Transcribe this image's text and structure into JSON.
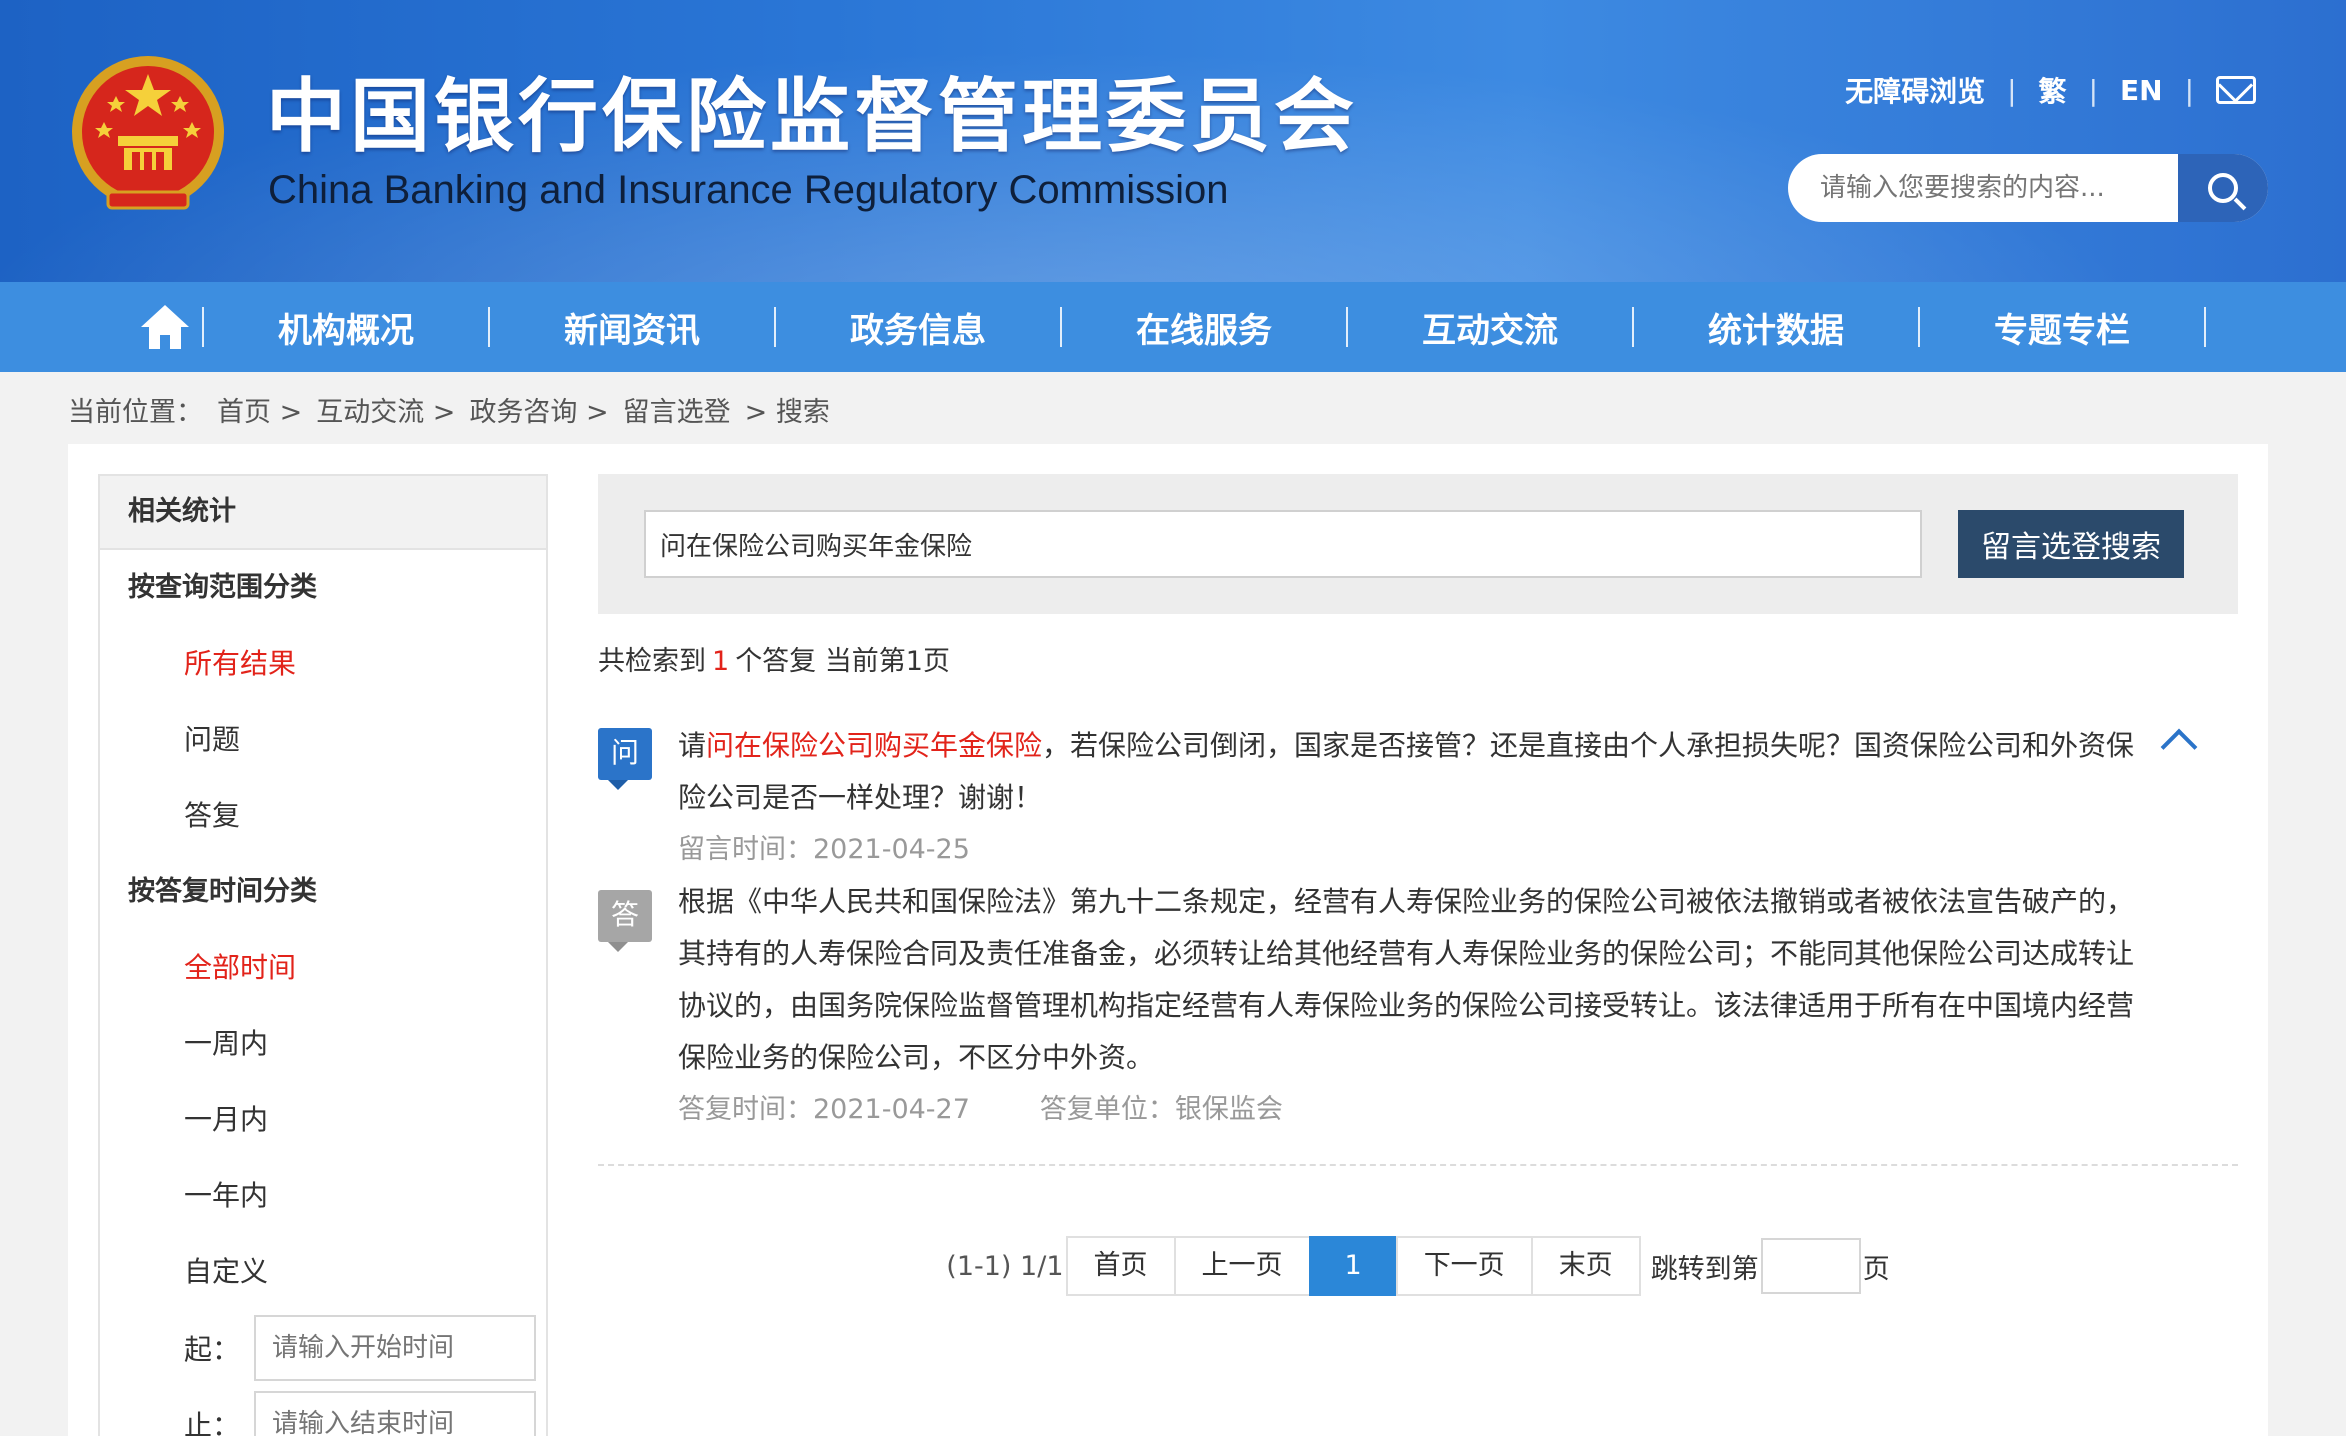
{
  "header": {
    "title_cn": "中国银行保险监督管理委员会",
    "title_en": "China Banking and Insurance Regulatory Commission",
    "links": {
      "accessibility": "无障碍浏览",
      "traditional": "繁",
      "english": "EN"
    },
    "search_placeholder": "请输入您要搜索的内容..."
  },
  "nav": {
    "items": [
      "机构概况",
      "新闻资讯",
      "政务信息",
      "在线服务",
      "互动交流",
      "统计数据",
      "专题专栏"
    ]
  },
  "breadcrumb": {
    "label": "当前位置：",
    "items": [
      "首页 >",
      "互动交流 >",
      "政务咨询 >",
      "留言选登",
      "> 搜索"
    ]
  },
  "sidebar": {
    "title": "相关统计",
    "scope_group": "按查询范围分类",
    "scope_items": [
      "所有结果",
      "问题",
      "答复"
    ],
    "time_group": "按答复时间分类",
    "time_items": [
      "全部时间",
      "一周内",
      "一月内",
      "一年内",
      "自定义"
    ],
    "start_label": "起：",
    "start_placeholder": "请输入开始时间",
    "end_label": "止：",
    "end_placeholder": "请输入结束时间"
  },
  "search": {
    "query": "问在保险公司购买年金保险",
    "button": "留言选登搜索"
  },
  "summary": {
    "prefix": "共检索到",
    "count": "1",
    "middle": "个答复  当前第",
    "page": "1页"
  },
  "result": {
    "q_badge": "问",
    "a_badge": "答",
    "question_pre": "请",
    "question_highlight": "问在保险公司购买年金保险",
    "question_post": "，若保险公司倒闭，国家是否接管？还是直接由个人承担损失呢？国资保险公司和外资保险公司是否一样处理？谢谢！",
    "question_time_label": "留言时间：",
    "question_time": "2021-04-25",
    "answer": "根据《中华人民共和国保险法》第九十二条规定，经营有人寿保险业务的保险公司被依法撤销或者被依法宣告破产的，其持有的人寿保险合同及责任准备金，必须转让给其他经营有人寿保险业务的保险公司；不能同其他保险公司达成转让协议的，由国务院保险监督管理机构指定经营有人寿保险业务的保险公司接受转让。该法律适用于所有在中国境内经营保险业务的保险公司，不区分中外资。",
    "answer_time_label": "答复时间：",
    "answer_time": "2021-04-27",
    "answer_unit_label": "答复单位：",
    "answer_unit": "银保监会"
  },
  "pager": {
    "info": "(1-1) 1/1",
    "first": "首页",
    "prev": "上一页",
    "current": "1",
    "next": "下一页",
    "last": "末页",
    "jump_label": "跳转到第",
    "jump_suffix": "页"
  },
  "colors": {
    "header_blue": "#2a76d6",
    "nav_blue": "#3d8ee0",
    "highlight_red": "#e2231a",
    "button_navy": "#2b4a6b"
  }
}
